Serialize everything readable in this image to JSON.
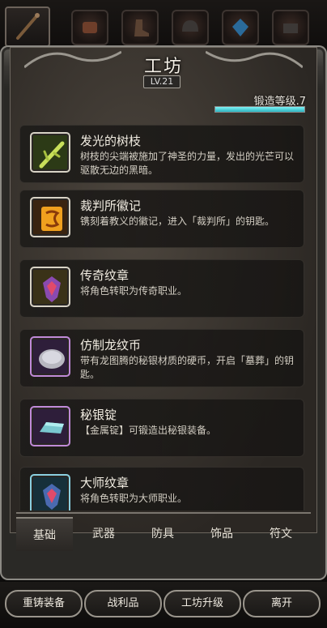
{
  "header": {
    "title": "工坊",
    "level": "LV.21"
  },
  "top_tabs": [
    {
      "icon": "staff-icon",
      "active": true
    },
    {
      "icon": "bracer-icon",
      "active": false
    },
    {
      "icon": "boot-icon",
      "active": false
    },
    {
      "icon": "helmet-icon",
      "active": false
    },
    {
      "icon": "gem-icon",
      "active": false
    },
    {
      "icon": "chest-icon",
      "active": false
    }
  ],
  "forge": {
    "label": "锻造等级.7",
    "progress": 1.0
  },
  "items": [
    {
      "name": "发光的树枝",
      "desc": "树枝的尖端被施加了神圣的力量，发出的光芒可以驱散无边的黑暗。",
      "icon": "glowing-branch-icon",
      "color": "#c8e05a"
    },
    {
      "name": "裁判所徽记",
      "desc": "镌刻着教义的徽记，进入「裁判所」的钥匙。",
      "icon": "inquisition-seal-icon",
      "color": "#f0a01e"
    },
    {
      "name": "传奇纹章",
      "desc": "将角色转职为传奇职业。",
      "icon": "legendary-crest-icon",
      "color": "#e0c040"
    },
    {
      "name": "仿制龙纹币",
      "desc": "带有龙图腾的秘银材质的硬币，开启「墓葬」的钥匙。",
      "icon": "dragon-coin-icon",
      "color": "#b070d0"
    },
    {
      "name": "秘银锭",
      "desc": "【金属锭】可锻造出秘银装备。",
      "icon": "mithril-ingot-icon",
      "color": "#b070d0"
    },
    {
      "name": "大师纹章",
      "desc": "将角色转职为大师职业。",
      "icon": "master-crest-icon",
      "color": "#60c0e0"
    }
  ],
  "bottom_tabs": [
    {
      "label": "基础",
      "active": true
    },
    {
      "label": "武器",
      "active": false
    },
    {
      "label": "防具",
      "active": false
    },
    {
      "label": "饰品",
      "active": false
    },
    {
      "label": "符文",
      "active": false
    }
  ],
  "actions": {
    "recast": "重铸装备",
    "loot": "战利品",
    "upgrade": "工坊升级",
    "leave": "离开"
  }
}
